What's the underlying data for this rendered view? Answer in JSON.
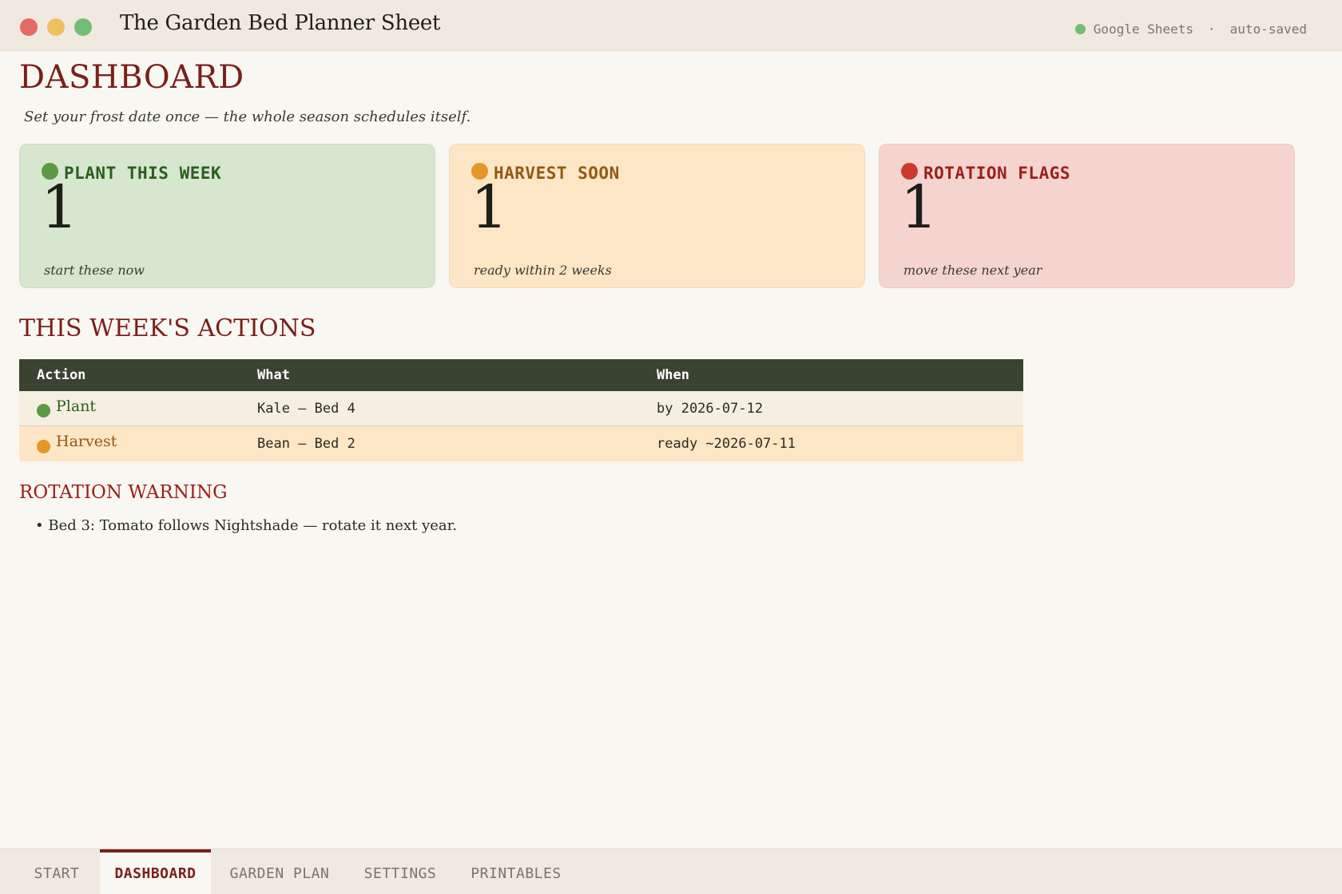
{
  "window": {
    "title": "The Garden Bed Planner Sheet",
    "app_name": "Google Sheets",
    "separator": "·",
    "save_status": "auto-saved"
  },
  "page": {
    "title": "DASHBOARD",
    "subtitle": "Set your frost date once — the whole season schedules itself."
  },
  "cards": [
    {
      "label": "PLANT THIS WEEK",
      "value": "1",
      "note": "start these now",
      "color": "#5b9a45"
    },
    {
      "label": "HARVEST SOON",
      "value": "1",
      "note": "ready within 2 weeks",
      "color": "#e49628"
    },
    {
      "label": "ROTATION FLAGS",
      "value": "1",
      "note": "move these next year",
      "color": "#cc3b30"
    }
  ],
  "actions": {
    "title": "THIS WEEK'S ACTIONS",
    "columns": [
      "Action",
      "What",
      "When"
    ],
    "rows": [
      {
        "action": "Plant",
        "what": "Kale — Bed 4",
        "when": "by 2026-07-12"
      },
      {
        "action": "Harvest",
        "what": "Bean — Bed 2",
        "when": "ready ~2026-07-11"
      }
    ]
  },
  "rotation": {
    "title": "ROTATION WARNING",
    "items": [
      "• Bed 3: Tomato follows Nightshade — rotate it next year."
    ]
  },
  "tabs": [
    {
      "label": "START",
      "active": false
    },
    {
      "label": "DASHBOARD",
      "active": true
    },
    {
      "label": "GARDEN PLAN",
      "active": false
    },
    {
      "label": "SETTINGS",
      "active": false
    },
    {
      "label": "PRINTABLES",
      "active": false
    }
  ]
}
